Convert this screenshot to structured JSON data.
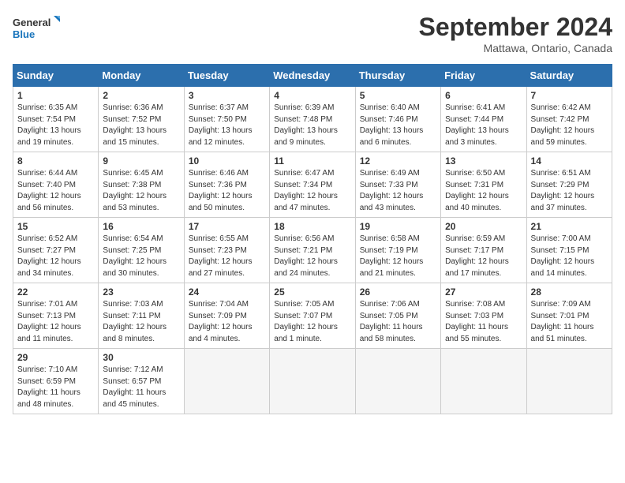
{
  "header": {
    "logo_line1": "General",
    "logo_line2": "Blue",
    "month": "September 2024",
    "location": "Mattawa, Ontario, Canada"
  },
  "weekdays": [
    "Sunday",
    "Monday",
    "Tuesday",
    "Wednesday",
    "Thursday",
    "Friday",
    "Saturday"
  ],
  "weeks": [
    [
      {
        "day": "1",
        "sunrise": "6:35 AM",
        "sunset": "7:54 PM",
        "daylight": "13 hours and 19 minutes."
      },
      {
        "day": "2",
        "sunrise": "6:36 AM",
        "sunset": "7:52 PM",
        "daylight": "13 hours and 15 minutes."
      },
      {
        "day": "3",
        "sunrise": "6:37 AM",
        "sunset": "7:50 PM",
        "daylight": "13 hours and 12 minutes."
      },
      {
        "day": "4",
        "sunrise": "6:39 AM",
        "sunset": "7:48 PM",
        "daylight": "13 hours and 9 minutes."
      },
      {
        "day": "5",
        "sunrise": "6:40 AM",
        "sunset": "7:46 PM",
        "daylight": "13 hours and 6 minutes."
      },
      {
        "day": "6",
        "sunrise": "6:41 AM",
        "sunset": "7:44 PM",
        "daylight": "13 hours and 3 minutes."
      },
      {
        "day": "7",
        "sunrise": "6:42 AM",
        "sunset": "7:42 PM",
        "daylight": "12 hours and 59 minutes."
      }
    ],
    [
      {
        "day": "8",
        "sunrise": "6:44 AM",
        "sunset": "7:40 PM",
        "daylight": "12 hours and 56 minutes."
      },
      {
        "day": "9",
        "sunrise": "6:45 AM",
        "sunset": "7:38 PM",
        "daylight": "12 hours and 53 minutes."
      },
      {
        "day": "10",
        "sunrise": "6:46 AM",
        "sunset": "7:36 PM",
        "daylight": "12 hours and 50 minutes."
      },
      {
        "day": "11",
        "sunrise": "6:47 AM",
        "sunset": "7:34 PM",
        "daylight": "12 hours and 47 minutes."
      },
      {
        "day": "12",
        "sunrise": "6:49 AM",
        "sunset": "7:33 PM",
        "daylight": "12 hours and 43 minutes."
      },
      {
        "day": "13",
        "sunrise": "6:50 AM",
        "sunset": "7:31 PM",
        "daylight": "12 hours and 40 minutes."
      },
      {
        "day": "14",
        "sunrise": "6:51 AM",
        "sunset": "7:29 PM",
        "daylight": "12 hours and 37 minutes."
      }
    ],
    [
      {
        "day": "15",
        "sunrise": "6:52 AM",
        "sunset": "7:27 PM",
        "daylight": "12 hours and 34 minutes."
      },
      {
        "day": "16",
        "sunrise": "6:54 AM",
        "sunset": "7:25 PM",
        "daylight": "12 hours and 30 minutes."
      },
      {
        "day": "17",
        "sunrise": "6:55 AM",
        "sunset": "7:23 PM",
        "daylight": "12 hours and 27 minutes."
      },
      {
        "day": "18",
        "sunrise": "6:56 AM",
        "sunset": "7:21 PM",
        "daylight": "12 hours and 24 minutes."
      },
      {
        "day": "19",
        "sunrise": "6:58 AM",
        "sunset": "7:19 PM",
        "daylight": "12 hours and 21 minutes."
      },
      {
        "day": "20",
        "sunrise": "6:59 AM",
        "sunset": "7:17 PM",
        "daylight": "12 hours and 17 minutes."
      },
      {
        "day": "21",
        "sunrise": "7:00 AM",
        "sunset": "7:15 PM",
        "daylight": "12 hours and 14 minutes."
      }
    ],
    [
      {
        "day": "22",
        "sunrise": "7:01 AM",
        "sunset": "7:13 PM",
        "daylight": "12 hours and 11 minutes."
      },
      {
        "day": "23",
        "sunrise": "7:03 AM",
        "sunset": "7:11 PM",
        "daylight": "12 hours and 8 minutes."
      },
      {
        "day": "24",
        "sunrise": "7:04 AM",
        "sunset": "7:09 PM",
        "daylight": "12 hours and 4 minutes."
      },
      {
        "day": "25",
        "sunrise": "7:05 AM",
        "sunset": "7:07 PM",
        "daylight": "12 hours and 1 minute."
      },
      {
        "day": "26",
        "sunrise": "7:06 AM",
        "sunset": "7:05 PM",
        "daylight": "11 hours and 58 minutes."
      },
      {
        "day": "27",
        "sunrise": "7:08 AM",
        "sunset": "7:03 PM",
        "daylight": "11 hours and 55 minutes."
      },
      {
        "day": "28",
        "sunrise": "7:09 AM",
        "sunset": "7:01 PM",
        "daylight": "11 hours and 51 minutes."
      }
    ],
    [
      {
        "day": "29",
        "sunrise": "7:10 AM",
        "sunset": "6:59 PM",
        "daylight": "11 hours and 48 minutes."
      },
      {
        "day": "30",
        "sunrise": "7:12 AM",
        "sunset": "6:57 PM",
        "daylight": "11 hours and 45 minutes."
      },
      null,
      null,
      null,
      null,
      null
    ]
  ],
  "labels": {
    "sunrise": "Sunrise:",
    "sunset": "Sunset:",
    "daylight": "Daylight:"
  }
}
